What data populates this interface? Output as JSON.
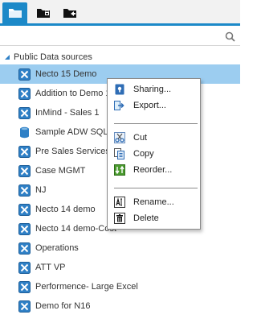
{
  "colors": {
    "accent": "#1c89c8",
    "selected_row": "#9ccdf0",
    "cube_icon": "#2f80c6"
  },
  "tabs": [
    {
      "icon": "folder-icon",
      "active": true
    },
    {
      "icon": "lock-folder-icon",
      "active": false
    },
    {
      "icon": "share-folder-icon",
      "active": false
    }
  ],
  "search": {
    "value": "",
    "icon": "search-icon"
  },
  "group": {
    "label": "Public Data sources",
    "expanded": true
  },
  "items": [
    {
      "label": "Necto 15 Demo",
      "icon": "cube-icon",
      "selected": true
    },
    {
      "label": "Addition to Demo 1",
      "icon": "cube-icon"
    },
    {
      "label": "InMind - Sales 1",
      "icon": "cube-icon"
    },
    {
      "label": "Sample ADW SQL",
      "icon": "database-icon"
    },
    {
      "label": "Pre Sales Services",
      "icon": "cube-icon"
    },
    {
      "label": "Case MGMT",
      "icon": "cube-icon"
    },
    {
      "label": "NJ",
      "icon": "cube-icon"
    },
    {
      "label": "Necto 14 demo",
      "icon": "cube-icon"
    },
    {
      "label": "Necto 14 demo-Cost",
      "icon": "cube-icon"
    },
    {
      "label": "Operations",
      "icon": "cube-icon"
    },
    {
      "label": "ATT VP",
      "icon": "cube-icon"
    },
    {
      "label": "Performence- Large Excel",
      "icon": "cube-icon"
    },
    {
      "label": "Demo for N16",
      "icon": "cube-icon"
    }
  ],
  "context_menu": {
    "items": [
      {
        "label": "Sharing...",
        "icon": "lock-icon"
      },
      {
        "label": "Export...",
        "icon": "export-icon"
      },
      {
        "label": "Cut",
        "icon": "scissors-icon"
      },
      {
        "label": "Copy",
        "icon": "copy-icon"
      },
      {
        "label": "Reorder...",
        "icon": "reorder-icon"
      },
      {
        "label": "Rename...",
        "icon": "rename-icon"
      },
      {
        "label": "Delete",
        "icon": "trash-icon"
      }
    ]
  }
}
